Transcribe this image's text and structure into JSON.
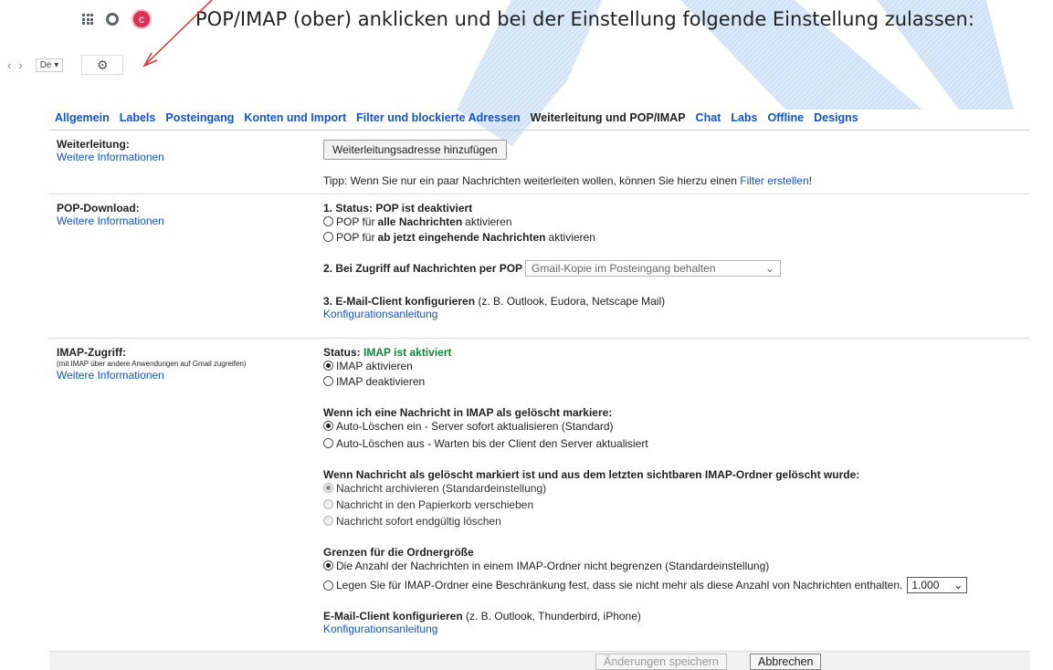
{
  "top": {
    "lang": "De",
    "avatar_letter": "c"
  },
  "instruction": "POP/IMAP (ober) anklicken und bei der Einstellung  folgende Einstellung zulassen:",
  "tabs": [
    "Allgemein",
    "Labels",
    "Posteingang",
    "Konten und Import",
    "Filter und blockierte Adressen",
    "Weiterleitung und POP/IMAP",
    "Chat",
    "Labs",
    "Offline",
    "Designs"
  ],
  "forwarding": {
    "label": "Weiterleitung:",
    "more": "Weitere Informationen",
    "add_button": "Weiterleitungsadresse hinzufügen",
    "tip_before": "Tipp: Wenn Sie nur ein paar Nachrichten weiterleiten wollen, können Sie hierzu einen ",
    "tip_link": "Filter erstellen",
    "tip_after": "!"
  },
  "pop": {
    "label": "POP-Download:",
    "more": "Weitere Informationen",
    "status": "1. Status: POP ist deaktiviert",
    "opt1_a": "POP für ",
    "opt1_b": "alle Nachrichten",
    "opt1_c": " aktivieren",
    "opt2_a": "POP für ",
    "opt2_b": "ab jetzt eingehende Nachrichten",
    "opt2_c": " aktivieren",
    "access_label": "2. Bei Zugriff auf Nachrichten per POP",
    "access_value": "Gmail-Kopie im Posteingang behalten",
    "client_bold": "3. E-Mail-Client konfigurieren",
    "client_rest": " (z. B. Outlook, Eudora, Netscape Mail)",
    "config_link": "Konfigurationsanleitung"
  },
  "imap": {
    "label": "IMAP-Zugriff:",
    "sub": "(mit IMAP über andere Anwendungen auf Gmail zugreifen)",
    "more": "Weitere Informationen",
    "status_label": "Status: ",
    "status_value": "IMAP ist aktiviert",
    "enable": "IMAP aktivieren",
    "disable": "IMAP deaktivieren",
    "delete_heading": "Wenn ich eine Nachricht in IMAP als gelöscht markiere:",
    "auto_on": "Auto-Löschen ein - Server sofort aktualisieren (Standard)",
    "auto_off": "Auto-Löschen aus - Warten bis der Client den Server aktualisiert",
    "expunge_heading": "Wenn Nachricht als gelöscht markiert ist und aus dem letzten sichtbaren IMAP-Ordner gelöscht wurde:",
    "archive": "Nachricht archivieren (Standardeinstellung)",
    "trash": "Nachricht in den Papierkorb verschieben",
    "delete_forever": "Nachricht sofort endgültig löschen",
    "folder_heading": "Grenzen für die Ordnergröße",
    "no_limit": "Die Anzahl der Nachrichten in einem IMAP-Ordner nicht begrenzen (Standardeinstellung)",
    "limit": "Legen Sie für IMAP-Ordner eine Beschränkung fest, dass sie nicht mehr als diese Anzahl von Nachrichten enthalten.",
    "limit_value": "1.000",
    "client_bold": "E-Mail-Client konfigurieren",
    "client_rest": " (z. B. Outlook, Thunderbird, iPhone)",
    "config_link": "Konfigurationsanleitung"
  },
  "footer": {
    "save": "Änderungen speichern",
    "cancel": "Abbrechen"
  },
  "colors": {
    "link": "#1155cc",
    "status_green": "#16833a",
    "watermark": "#cfe2f7"
  }
}
